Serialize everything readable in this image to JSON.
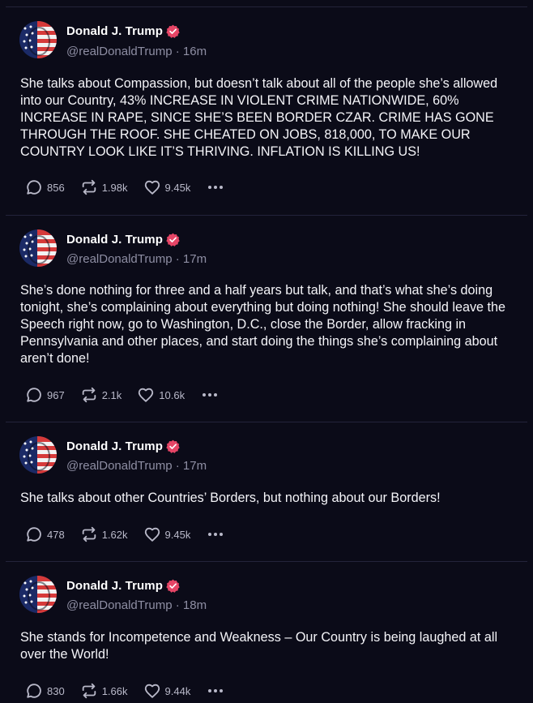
{
  "posts": [
    {
      "author": "Donald J. Trump",
      "handle": "@realDonaldTrump",
      "separator": "·",
      "time": "16m",
      "text": "She talks about Compassion, but doesn’t talk about all of the people she’s allowed into our Country, 43% INCREASE IN VIOLENT CRIME NATIONWIDE, 60% INCREASE IN RAPE, SINCE SHE’S BEEN BORDER CZAR. CRIME HAS GONE THROUGH THE ROOF. SHE CHEATED ON JOBS, 818,000, TO MAKE OUR COUNTRY LOOK LIKE IT’S THRIVING. INFLATION IS KILLING US!",
      "replies": "856",
      "reposts": "1.98k",
      "likes": "9.45k"
    },
    {
      "author": "Donald J. Trump",
      "handle": "@realDonaldTrump",
      "separator": "·",
      "time": "17m",
      "text": "She’s done nothing for three and a half years but talk, and that’s what she’s doing tonight, she’s complaining about everything but doing nothing! She should leave the Speech right now, go to Washington, D.C., close the Border, allow fracking in Pennsylvania and other places, and start doing the things she’s complaining about aren’t done!",
      "replies": "967",
      "reposts": "2.1k",
      "likes": "10.6k"
    },
    {
      "author": "Donald J. Trump",
      "handle": "@realDonaldTrump",
      "separator": "·",
      "time": "17m",
      "text": "She talks about other Countries’ Borders, but nothing about our Borders!",
      "replies": "478",
      "reposts": "1.62k",
      "likes": "9.45k"
    },
    {
      "author": "Donald J. Trump",
      "handle": "@realDonaldTrump",
      "separator": "·",
      "time": "18m",
      "text": "She stands for Incompetence and Weakness – Our Country is being laughed at all over the World!",
      "replies": "830",
      "reposts": "1.66k",
      "likes": "9.44k"
    }
  ],
  "icons": {
    "reply": "reply-bubble-icon",
    "repost": "repost-arrows-icon",
    "like": "heart-icon",
    "more": "more-dots-icon",
    "verified": "verified-badge-icon"
  },
  "colors": {
    "background": "#0b0b18",
    "divider": "#23233a",
    "badge": "#e64566",
    "muted_text": "#8e8ea3"
  }
}
